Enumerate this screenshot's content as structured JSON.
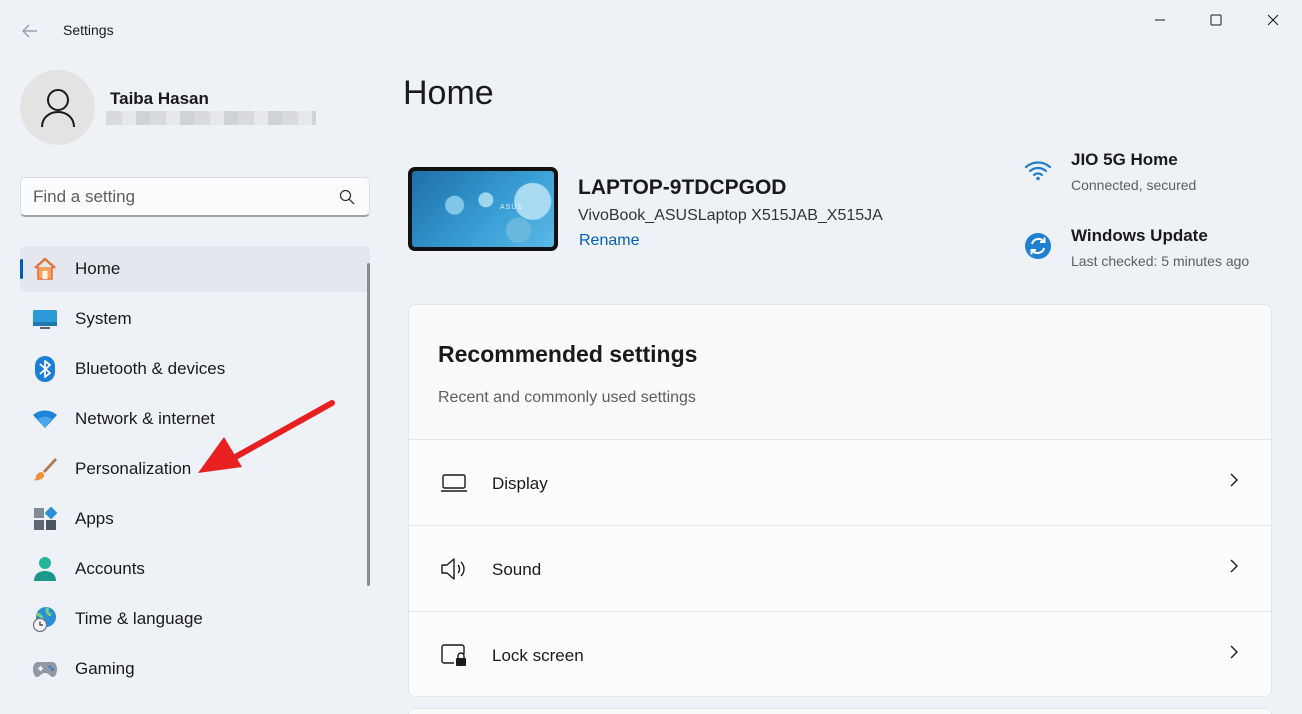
{
  "window": {
    "title": "Settings",
    "controls": [
      "minimize-icon",
      "maximize-icon",
      "close-icon"
    ]
  },
  "profile": {
    "name": "Taiba Hasan"
  },
  "search": {
    "placeholder": "Find a setting"
  },
  "nav": {
    "items": [
      {
        "label": "Home",
        "icon": "home-icon",
        "active": true
      },
      {
        "label": "System",
        "icon": "system-icon"
      },
      {
        "label": "Bluetooth & devices",
        "icon": "bluetooth-icon"
      },
      {
        "label": "Network & internet",
        "icon": "wifi-icon"
      },
      {
        "label": "Personalization",
        "icon": "brush-icon"
      },
      {
        "label": "Apps",
        "icon": "apps-icon"
      },
      {
        "label": "Accounts",
        "icon": "accounts-icon"
      },
      {
        "label": "Time & language",
        "icon": "time-language-icon"
      },
      {
        "label": "Gaming",
        "icon": "gaming-icon"
      }
    ]
  },
  "main": {
    "title": "Home",
    "device": {
      "name": "LAPTOP-9TDCPGOD",
      "model": "VivoBook_ASUSLaptop X515JAB_X515JA",
      "rename_label": "Rename",
      "wallpaper_mark": "ASUS"
    },
    "network": {
      "title": "JIO 5G Home",
      "status": "Connected, secured"
    },
    "update": {
      "title": "Windows Update",
      "status": "Last checked: 5 minutes ago"
    },
    "recommended": {
      "title": "Recommended settings",
      "subtitle": "Recent and commonly used settings",
      "rows": [
        {
          "label": "Display",
          "icon": "display-icon"
        },
        {
          "label": "Sound",
          "icon": "sound-icon"
        },
        {
          "label": "Lock screen",
          "icon": "lock-screen-icon"
        }
      ]
    }
  },
  "colors": {
    "accent": "#005fb8",
    "background": "#eef2f7",
    "annotation": "#e8201f"
  }
}
